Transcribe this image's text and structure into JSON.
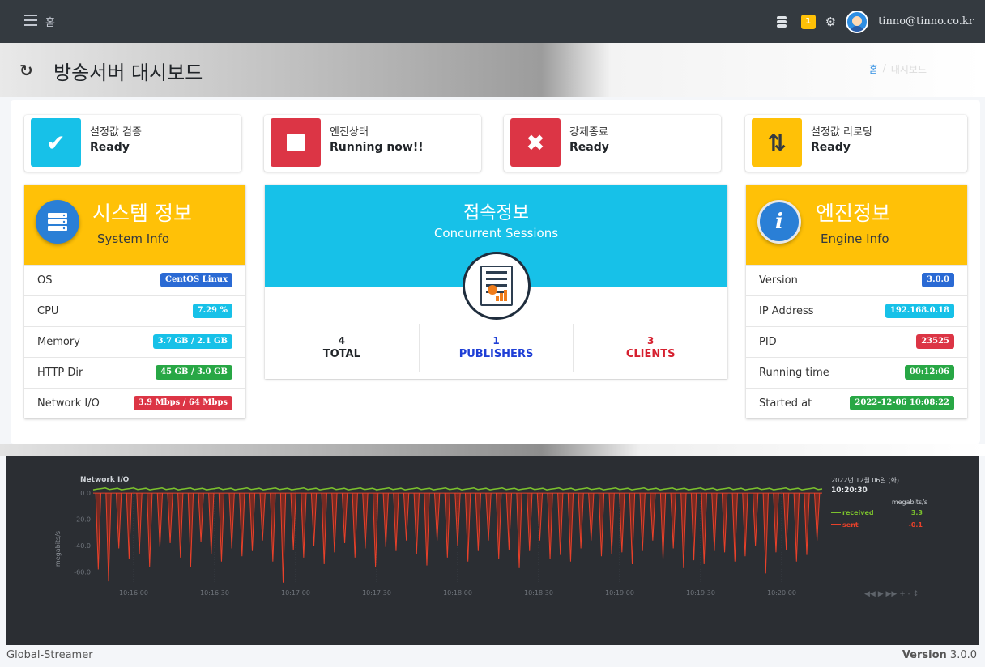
{
  "topbar": {
    "home_label": "홈",
    "notification_count": "1",
    "user_email": "tinno@tinno.co.kr"
  },
  "header": {
    "title": "방송서버 대시보드",
    "breadcrumb_home": "홈",
    "breadcrumb_current": "대시보드"
  },
  "status_boxes": [
    {
      "label": "설정값 검증",
      "value": "Ready",
      "icon": "check-icon",
      "color": "#17c1e8"
    },
    {
      "label": "엔진상태",
      "value": "Running now!!",
      "icon": "stop-icon",
      "color": "#dc3545"
    },
    {
      "label": "강제종료",
      "value": "Ready",
      "icon": "tools-icon",
      "color": "#dc3545"
    },
    {
      "label": "설정값 리로딩",
      "value": "Ready",
      "icon": "reload-icon",
      "color": "#ffc107"
    }
  ],
  "system_info": {
    "title": "시스템 정보",
    "subtitle": "System Info",
    "rows": [
      {
        "key": "OS",
        "value": "CentOS Linux",
        "color": "#2a6ad4"
      },
      {
        "key": "CPU",
        "value": "7.29 %",
        "color": "#17c1e8"
      },
      {
        "key": "Memory",
        "value": "3.7 GB / 2.1 GB",
        "color": "#17c1e8"
      },
      {
        "key": "HTTP Dir",
        "value": "45 GB / 3.0 GB",
        "color": "#28a745"
      },
      {
        "key": "Network I/O",
        "value": "3.9 Mbps / 64 Mbps",
        "color": "#dc3545"
      }
    ]
  },
  "sessions": {
    "title": "접속정보",
    "subtitle": "Concurrent Sessions",
    "total": "4",
    "total_label": "TOTAL",
    "publishers": "1",
    "publishers_label": "PUBLISHERS",
    "clients": "3",
    "clients_label": "CLIENTS"
  },
  "engine_info": {
    "title": "엔진정보",
    "subtitle": "Engine Info",
    "rows": [
      {
        "key": "Version",
        "value": "3.0.0",
        "color": "#2a6ad4"
      },
      {
        "key": "IP Address",
        "value": "192.168.0.18",
        "color": "#17c1e8"
      },
      {
        "key": "PID",
        "value": "23525",
        "color": "#dc3545"
      },
      {
        "key": "Running time",
        "value": "00:12:06",
        "color": "#28a745"
      },
      {
        "key": "Started at",
        "value": "2022-12-06 10:08:22",
        "color": "#28a745"
      }
    ]
  },
  "chart_data": {
    "type": "area",
    "title": "Network I/O",
    "ylabel": "megabits/s",
    "ylim": [
      -70,
      5
    ],
    "y_ticks": [
      "0.0",
      "-20.0",
      "-40.0",
      "-60.0"
    ],
    "x_ticks": [
      "10:16:00",
      "10:16:30",
      "10:17:00",
      "10:17:30",
      "10:18:00",
      "10:18:30",
      "10:19:00",
      "10:19:30",
      "10:20:00"
    ],
    "date_label": "2022년 12월 06일 (화)",
    "time_label": "10:20:30",
    "unit_label": "megabits/s",
    "legend": [
      {
        "name": "received",
        "value": "3.3",
        "color": "#7cc22d"
      },
      {
        "name": "sent",
        "value": "-0.1",
        "color": "#e8412a"
      }
    ],
    "series": [
      {
        "name": "received",
        "values": [
          3.3
        ]
      },
      {
        "name": "sent",
        "values": [
          -58,
          -67,
          -42,
          -50,
          -46,
          -56,
          -41,
          -38,
          -49,
          -56,
          -37,
          -46,
          -52,
          -42,
          -48,
          -44,
          -36,
          -52,
          -68,
          -43,
          -49,
          -40,
          -54,
          -45,
          -38,
          -49,
          -42,
          -56,
          -41,
          -44,
          -36,
          -46,
          -55,
          -36,
          -49,
          -40,
          -52,
          -44,
          -36,
          -50,
          -43,
          -57,
          -44,
          -36,
          -50,
          -47,
          -52,
          -42,
          -36,
          -48,
          -46,
          -45,
          -54,
          -44,
          -36,
          -50,
          -42,
          -57,
          -51,
          -54,
          -44,
          -45,
          -52,
          -48,
          -40,
          -61,
          -45,
          -43,
          -52,
          -47,
          -36
        ]
      }
    ],
    "controls": "◀◀ ▶ ▶▶ + - ↕"
  },
  "footer": {
    "app_name": "Global-Streamer",
    "version_label": "Version",
    "version_value": "3.0.0"
  }
}
